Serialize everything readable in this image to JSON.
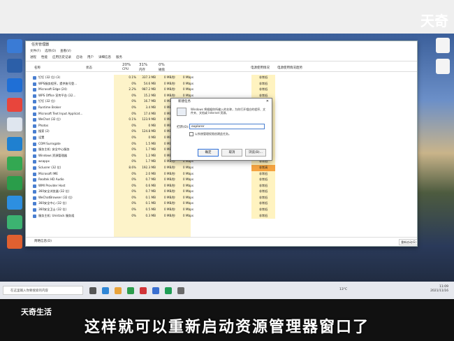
{
  "brand": {
    "logo": "天奇",
    "watermark": "天奇生活"
  },
  "caption": "这样就可以重新启动资源管理器窗口了",
  "task_manager": {
    "title": "任务管理器",
    "menu": [
      "文件(F)",
      "选项(O)",
      "查看(V)"
    ],
    "tabs": [
      "进程",
      "性能",
      "应用历史记录",
      "启动",
      "用户",
      "详细信息",
      "服务"
    ],
    "columns": {
      "name": "名称",
      "status": "状态",
      "cpu_pct": "20%",
      "mem_pct": "31%",
      "disk_pct": "0%",
      "net_pct": "0%",
      "cpu": "CPU",
      "mem": "内存",
      "disk": "磁盘",
      "net": "网络",
      "power": "电源使用情况",
      "power_trend": "电源使用情况趋势"
    },
    "rows": [
      {
        "name": "钉钉 (32 位) (3)",
        "cpu": "0.1%",
        "mem": "337.3 MB",
        "disk": "0 MB/秒",
        "net": "0 Mbps",
        "power": "非常低"
      },
      {
        "name": "WPS服务程序，提供账号登...",
        "cpu": "0%",
        "mem": "54.6 MB",
        "disk": "0 MB/秒",
        "net": "0 Mbps",
        "power": "非常低"
      },
      {
        "name": "Microsoft Edge (24)",
        "cpu": "2.2%",
        "mem": "987.2 MB",
        "disk": "0 MB/秒",
        "net": "0 Mbps",
        "power": "非常低"
      },
      {
        "name": "WPS Office 宣传平台 (32...",
        "cpu": "0%",
        "mem": "15.2 MB",
        "disk": "0 MB/秒",
        "net": "0 Mbps",
        "power": "非常低"
      },
      {
        "name": "钉钉 (32 位)",
        "cpu": "0%",
        "mem": "16.7 MB",
        "disk": "0 MB/秒",
        "net": "0 Mbps",
        "power": "非常低"
      },
      {
        "name": "Runtime Broker",
        "cpu": "0%",
        "mem": "3.4 MB",
        "disk": "0 MB/秒",
        "net": "0 Mbps",
        "power": "非常低"
      },
      {
        "name": "Microsoft Text Input Applicat...",
        "cpu": "0%",
        "mem": "17.4 MB",
        "disk": "0 MB/秒",
        "net": "0 Mbps",
        "power": "非常低"
      },
      {
        "name": "WeChat (32 位)",
        "cpu": "0.1%",
        "mem": "123.9 MB",
        "disk": "0 MB/秒",
        "net": "0 Mbps",
        "power": "非常低"
      },
      {
        "name": "Photos",
        "cpu": "0%",
        "mem": "0 MB",
        "disk": "0 MB/秒",
        "net": "0 Mbps",
        "power": "非常低"
      },
      {
        "name": "搜索 (2)",
        "cpu": "0%",
        "mem": "124.8 MB",
        "disk": "0 MB/秒",
        "net": "0 Mbps",
        "power": "非常低"
      },
      {
        "name": "设置",
        "cpu": "0%",
        "mem": "0 MB",
        "disk": "0 MB/秒",
        "net": "0 Mbps",
        "power": "非常低"
      },
      {
        "name": "COM Surrogate",
        "cpu": "0%",
        "mem": "1.5 MB",
        "disk": "0 MB/秒",
        "net": "0 Mbps",
        "power": "非常低"
      },
      {
        "name": "服务主机: 安全中心服务",
        "cpu": "0%",
        "mem": "1.7 MB",
        "disk": "0 MB/秒",
        "net": "0 Mbps",
        "power": "非常低"
      },
      {
        "name": "Windows 资源管理器",
        "cpu": "0%",
        "mem": "1.2 MB",
        "disk": "0 MB/秒",
        "net": "0 Mbps",
        "power": "非常低"
      },
      {
        "name": "wsappx",
        "cpu": "0%",
        "mem": "1.7 MB",
        "disk": "0 MB/秒",
        "net": "0 Mbps",
        "power": "非常低"
      },
      {
        "name": "Sclusrer (32 位)",
        "cpu": "8.6%",
        "mem": "192.3 MB",
        "disk": "0 MB/秒",
        "net": "0 Mbps",
        "power": "非常高"
      },
      {
        "name": "Microsoft IME",
        "cpu": "0%",
        "mem": "2.0 MB",
        "disk": "0 MB/秒",
        "net": "0 Mbps",
        "power": "非常低"
      },
      {
        "name": "Realtek HD Audio",
        "cpu": "0%",
        "mem": "0.7 MB",
        "disk": "0 MB/秒",
        "net": "0 Mbps",
        "power": "非常低"
      },
      {
        "name": "WMI Provider Host",
        "cpu": "0%",
        "mem": "0.6 MB",
        "disk": "0 MB/秒",
        "net": "0 Mbps",
        "power": "非常低"
      },
      {
        "name": "360安全浏览器 (32 位)",
        "cpu": "0%",
        "mem": "0.7 MB",
        "disk": "0 MB/秒",
        "net": "0 Mbps",
        "power": "非常低"
      },
      {
        "name": "WeChatBrowser (32 位)",
        "cpu": "0%",
        "mem": "0.1 MB",
        "disk": "0 MB/秒",
        "net": "0 Mbps",
        "power": "非常低"
      },
      {
        "name": "360安全中心 (32 位)",
        "cpu": "0%",
        "mem": "0.1 MB",
        "disk": "0 MB/秒",
        "net": "0 Mbps",
        "power": "非常低"
      },
      {
        "name": "360安全卫士 (32 位)",
        "cpu": "0%",
        "mem": "0.5 MB",
        "disk": "0 MB/秒",
        "net": "0 Mbps",
        "power": "非常低"
      },
      {
        "name": "服务主机: Unistack 服务组",
        "cpu": "0%",
        "mem": "0.3 MB",
        "disk": "0 MB/秒",
        "net": "0 Mbps",
        "power": "非常低"
      }
    ],
    "footer": "简略信息(D)",
    "footer_button": "重新启动(E)"
  },
  "run_dialog": {
    "title": "新建任务",
    "close": "✕",
    "description": "Windows 将根据你所输入的名称，为你打开相应的程序、文件夹、文档或 Internet 资源。",
    "open_label": "打开(O):",
    "input_value": "explorer",
    "checkbox_label": "以系统管理权限创建此任务。",
    "ok_label": "确定",
    "cancel_label": "取消",
    "browse_label": "浏览(B)..."
  },
  "taskbar": {
    "search_placeholder": "在这里输入你要搜索的内容",
    "weather": "13°C",
    "time": "11:09",
    "date": "2021/11/16"
  },
  "colors": {
    "taskbar": "#e6e8ee",
    "warn_high": "#f4a340",
    "cell_shade": "#fdf3c9"
  }
}
